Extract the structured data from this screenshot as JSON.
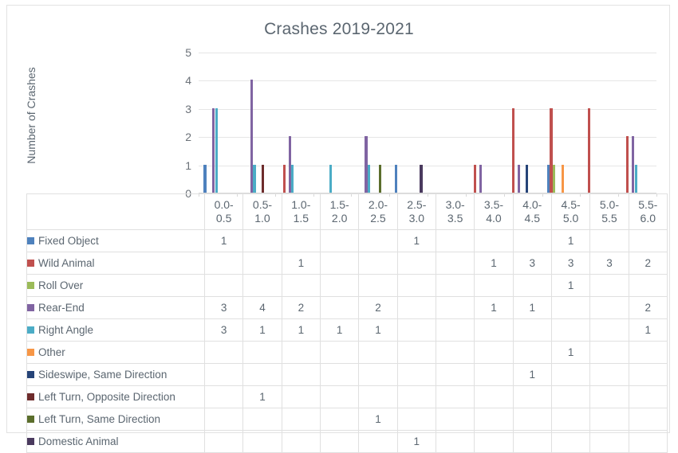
{
  "chart": {
    "title": "Crashes 2019-2021",
    "y_axis_title": "Number of Crashes"
  },
  "chart_data": {
    "type": "bar",
    "title": "Crashes 2019-2021",
    "xlabel": "",
    "ylabel": "Number of Crashes",
    "ylim": [
      0,
      5
    ],
    "yticks": [
      "0",
      "1",
      "2",
      "3",
      "4",
      "5"
    ],
    "grid": true,
    "legend_position": "data-table-below",
    "categories": [
      "0.0-0.5",
      "0.5-1.0",
      "1.0-1.5",
      "1.5-2.0",
      "2.0-2.5",
      "2.5-3.0",
      "3.0-3.5",
      "3.5-4.0",
      "4.0-4.5",
      "4.5-5.0",
      "5.0-5.5",
      "5.5-6.0"
    ],
    "category_lines": [
      [
        "0.0-",
        "0.5"
      ],
      [
        "0.5-",
        "1.0"
      ],
      [
        "1.0-",
        "1.5"
      ],
      [
        "1.5-",
        "2.0"
      ],
      [
        "2.0-",
        "2.5"
      ],
      [
        "2.5-",
        "3.0"
      ],
      [
        "3.0-",
        "3.5"
      ],
      [
        "3.5-",
        "4.0"
      ],
      [
        "4.0-",
        "4.5"
      ],
      [
        "4.5-",
        "5.0"
      ],
      [
        "5.0-",
        "5.5"
      ],
      [
        "5.5-",
        "6.0"
      ]
    ],
    "series": [
      {
        "name": "Fixed Object",
        "color": "#4E81BD",
        "values": [
          "1",
          "",
          "",
          "",
          "",
          "1",
          "",
          "",
          "",
          "1",
          "",
          ""
        ]
      },
      {
        "name": "Wild Animal",
        "color": "#C0504E",
        "values": [
          "",
          "",
          "1",
          "",
          "",
          "",
          "",
          "1",
          "3",
          "3",
          "3",
          "2"
        ]
      },
      {
        "name": "Roll Over",
        "color": "#9BBB59",
        "values": [
          "",
          "",
          "",
          "",
          "",
          "",
          "",
          "",
          "",
          "1",
          "",
          ""
        ]
      },
      {
        "name": "Rear-End",
        "color": "#8064A2",
        "values": [
          "3",
          "4",
          "2",
          "",
          "2",
          "",
          "",
          "1",
          "1",
          "",
          "",
          "2"
        ]
      },
      {
        "name": "Right Angle",
        "color": "#4BACC6",
        "values": [
          "3",
          "1",
          "1",
          "1",
          "1",
          "",
          "",
          "",
          "",
          "",
          "",
          "1"
        ]
      },
      {
        "name": "Other",
        "color": "#F79646",
        "values": [
          "",
          "",
          "",
          "",
          "",
          "",
          "",
          "",
          "",
          "1",
          "",
          ""
        ]
      },
      {
        "name": "Sideswipe, Same Direction",
        "color": "#264478",
        "values": [
          "",
          "",
          "",
          "",
          "",
          "",
          "",
          "",
          "1",
          "",
          "",
          ""
        ]
      },
      {
        "name": "Left Turn, Opposite Direction",
        "color": "#6E2C2C",
        "values": [
          "",
          "1",
          "",
          "",
          "",
          "",
          "",
          "",
          "",
          "",
          "",
          ""
        ]
      },
      {
        "name": "Left Turn, Same Direction",
        "color": "#5B6E2C",
        "values": [
          "",
          "",
          "",
          "",
          "1",
          "",
          "",
          "",
          "",
          "",
          "",
          ""
        ]
      },
      {
        "name": "Domestic Animal",
        "color": "#4A3A5E",
        "values": [
          "",
          "",
          "",
          "",
          "",
          "1",
          "",
          "",
          "",
          "",
          "",
          ""
        ]
      }
    ]
  }
}
